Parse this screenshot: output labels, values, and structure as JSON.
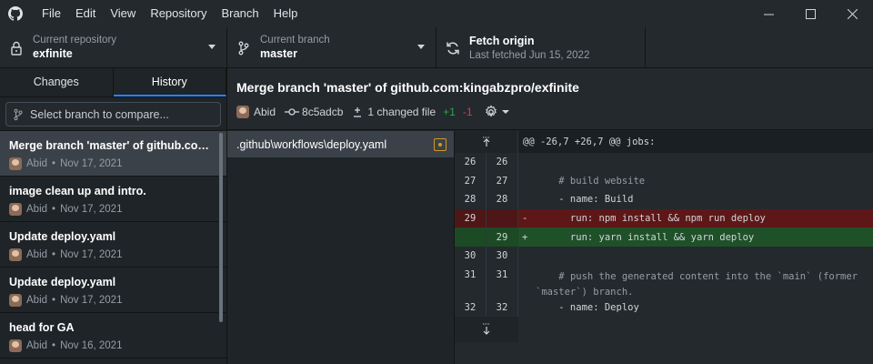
{
  "menu": [
    "File",
    "Edit",
    "View",
    "Repository",
    "Branch",
    "Help"
  ],
  "toolbar": {
    "repo_label": "Current repository",
    "repo_value": "exfinite",
    "branch_label": "Current branch",
    "branch_value": "master",
    "fetch_label": "Fetch origin",
    "fetch_value": "Last fetched Jun 15, 2022"
  },
  "sidebar": {
    "tabs": [
      "Changes",
      "History"
    ],
    "active_tab": "History",
    "compare_placeholder": "Select branch to compare...",
    "commits": [
      {
        "title": "Merge branch 'master' of github.com:k...",
        "author": "Abid",
        "date": "Nov 17, 2021",
        "selected": true
      },
      {
        "title": "image clean up and intro.",
        "author": "Abid",
        "date": "Nov 17, 2021"
      },
      {
        "title": "Update deploy.yaml",
        "author": "Abid",
        "date": "Nov 17, 2021"
      },
      {
        "title": "Update deploy.yaml",
        "author": "Abid",
        "date": "Nov 17, 2021"
      },
      {
        "title": "head for GA",
        "author": "Abid",
        "date": "Nov 16, 2021"
      }
    ]
  },
  "commit": {
    "title": "Merge branch 'master' of github.com:kingabzpro/exfinite",
    "author": "Abid",
    "sha": "8c5adcb",
    "changed": "1 changed file",
    "added": "+1",
    "removed": "-1"
  },
  "files": [
    {
      "name": ".github\\workflows\\deploy.yaml",
      "status": "modified"
    }
  ],
  "diff": {
    "hunk": "@@ -26,7 +26,7 @@ jobs:",
    "lines": [
      {
        "old": "26",
        "new": "26",
        "type": "ctx",
        "text": ""
      },
      {
        "old": "27",
        "new": "27",
        "type": "ctx",
        "text": "    # build website"
      },
      {
        "old": "28",
        "new": "28",
        "type": "ctx",
        "text": "    - name: Build"
      },
      {
        "old": "29",
        "new": "",
        "type": "del",
        "text": "      run: npm install && npm run deploy"
      },
      {
        "old": "",
        "new": "29",
        "type": "add",
        "text": "      run: yarn install && yarn deploy"
      },
      {
        "old": "30",
        "new": "30",
        "type": "ctx",
        "text": ""
      },
      {
        "old": "31",
        "new": "31",
        "type": "ctx",
        "text": "    # push the generated content into the `main` (former `master`) branch."
      },
      {
        "old": "32",
        "new": "32",
        "type": "ctx",
        "text": "    - name: Deploy"
      }
    ]
  },
  "colors": {
    "accent": "#2188ff",
    "added": "#28a745",
    "removed": "#d73a49",
    "modified": "#d29922"
  }
}
